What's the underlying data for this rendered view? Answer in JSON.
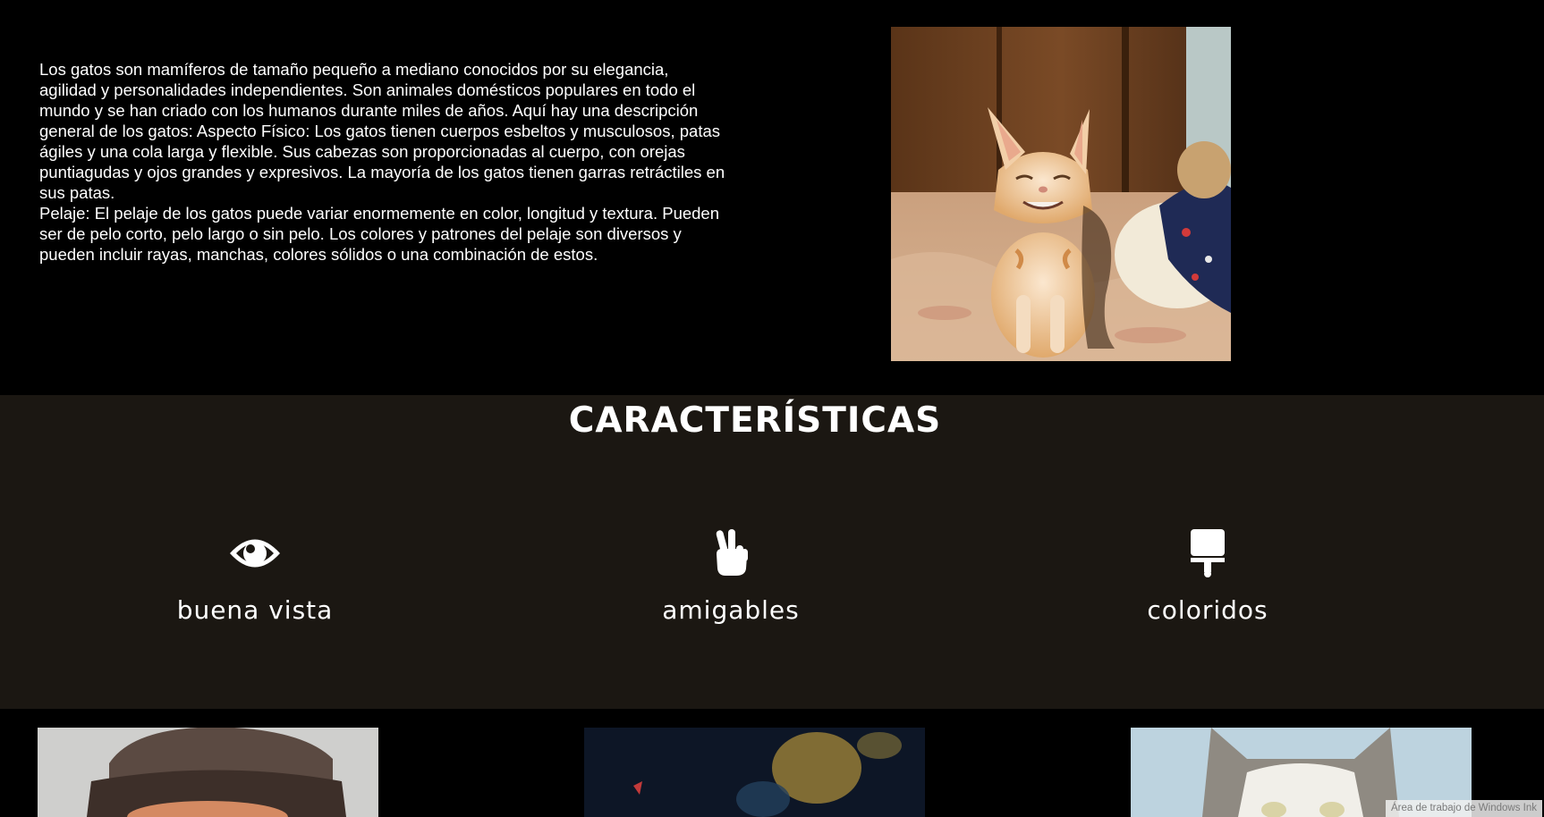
{
  "intro": {
    "paragraph_1": "Los gatos son mamíferos de tamaño pequeño a mediano conocidos por su elegancia, agilidad y personalidades independientes. Son animales domésticos populares en todo el mundo y se han criado con los humanos durante miles de años. Aquí hay una descripción general de los gatos: Aspecto Físico: Los gatos tienen cuerpos esbeltos y musculosos, patas ágiles y una cola larga y flexible. Sus cabezas son proporcionadas al cuerpo, con orejas puntiagudas y ojos grandes y expresivos. La mayoría de los gatos tienen garras retráctiles en sus patas.",
    "paragraph_2": "Pelaje: El pelaje de los gatos puede variar enormemente en color, longitud y textura. Pueden ser de pelo corto, pelo largo o sin pelo. Los colores y patrones del pelaje son diversos y pueden incluir rayas, manchas, colores sólidos o una combinación de estos."
  },
  "features": {
    "title": "CARACTERÍSTICAS",
    "items": [
      {
        "icon": "eye-icon",
        "label": "buena vista"
      },
      {
        "icon": "hand-peace-icon",
        "label": "amigables"
      },
      {
        "icon": "paint-roller-icon",
        "label": "coloridos"
      }
    ]
  },
  "system": {
    "ink_workspace": "Área de trabajo de Windows Ink"
  },
  "colors": {
    "page_background": "#000000",
    "features_background": "#1b1712",
    "text": "#ffffff"
  }
}
